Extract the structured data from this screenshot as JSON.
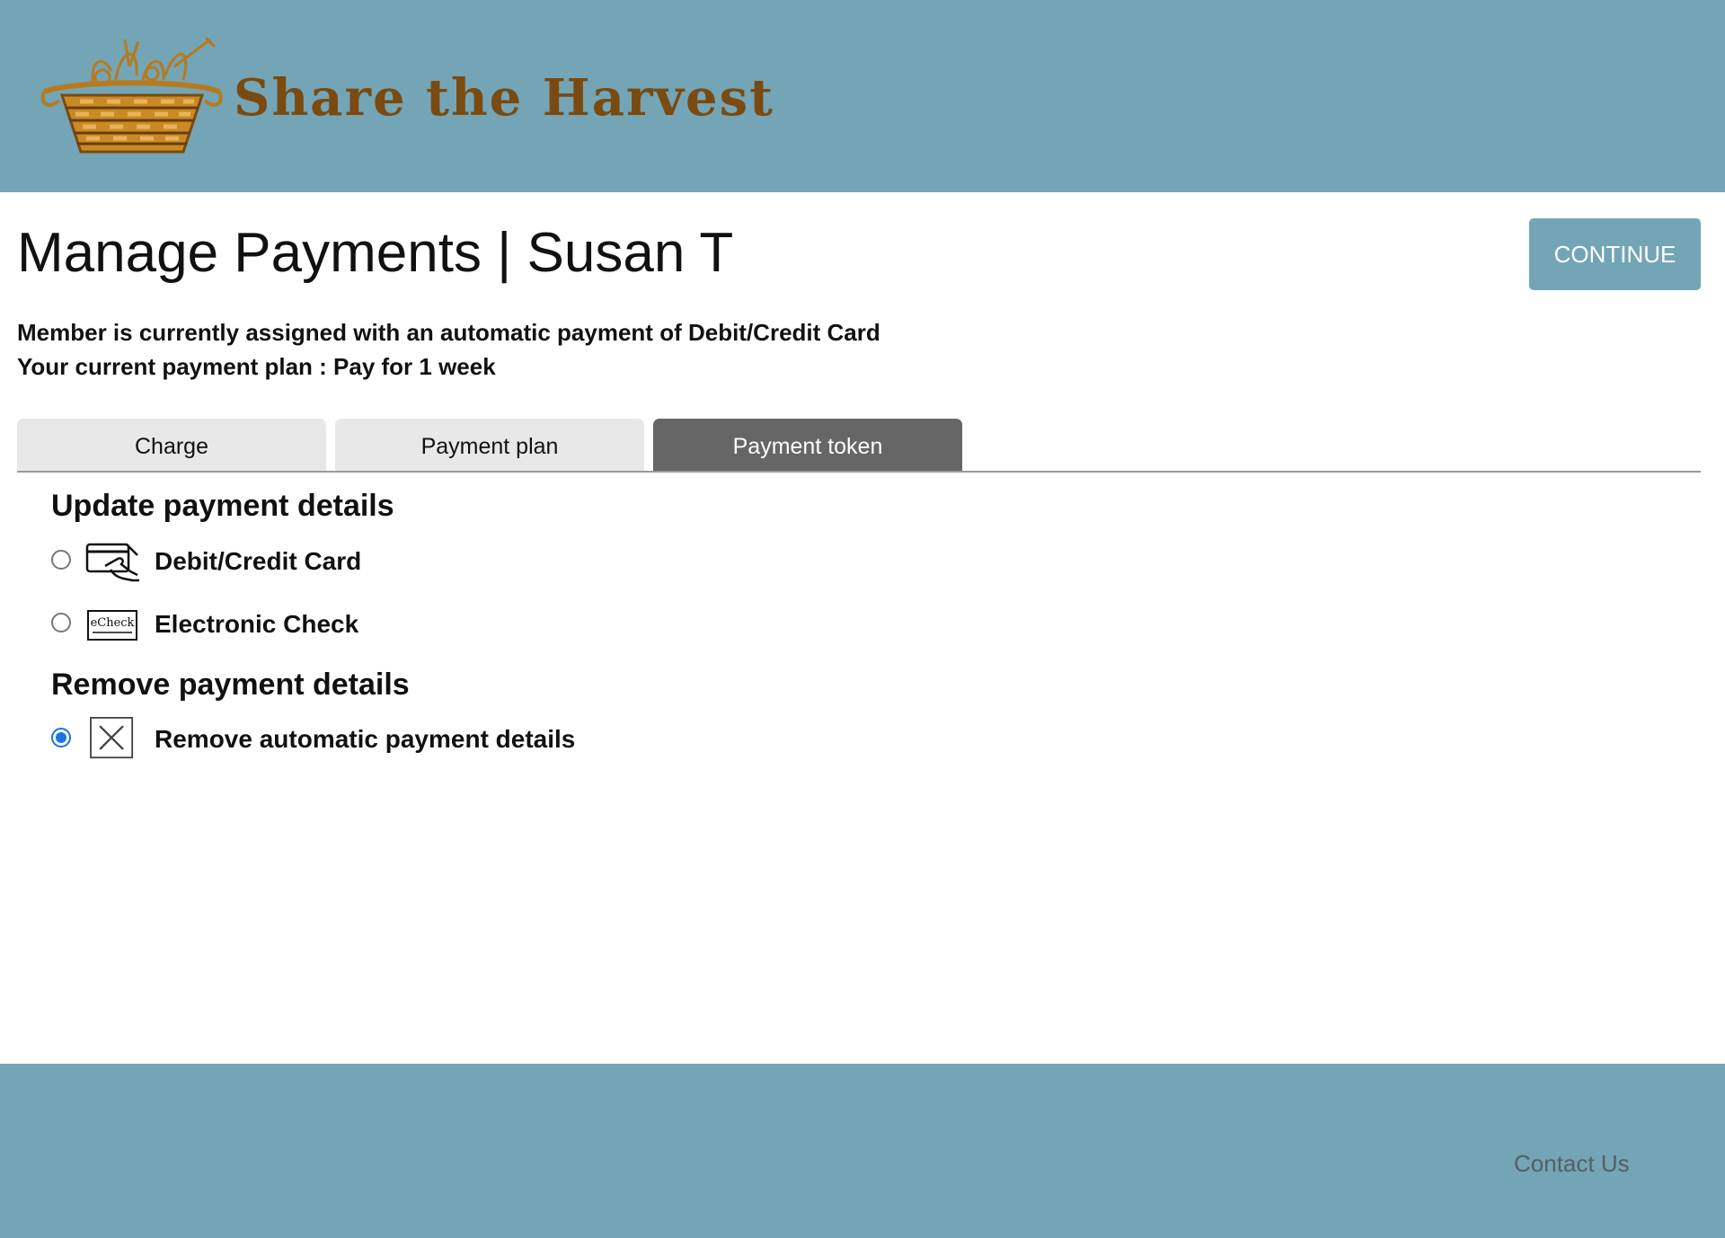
{
  "header": {
    "brand_name": "Share the Harvest",
    "logo_icon": "harvest-basket-logo",
    "background_color": "#73a5b6",
    "brand_color": "#7a4a10"
  },
  "main": {
    "title": "Manage Payments | Susan T",
    "continue_label": "CONTINUE",
    "info_lines": [
      "Member is currently assigned with an automatic payment of Debit/Credit Card",
      "Your current payment plan : Pay for 1 week"
    ],
    "tabs": [
      {
        "label": "Charge",
        "active": false
      },
      {
        "label": "Payment plan",
        "active": false
      },
      {
        "label": "Payment token",
        "active": true
      }
    ],
    "update_section": {
      "heading": "Update payment details",
      "options": [
        {
          "label": "Debit/Credit Card",
          "icon": "credit-card-icon",
          "checked": false
        },
        {
          "label": "Electronic Check",
          "icon": "echeck-icon",
          "icon_text": "eCheck",
          "checked": false
        }
      ]
    },
    "remove_section": {
      "heading": "Remove payment details",
      "options": [
        {
          "label": "Remove automatic payment details",
          "icon": "remove-x-icon",
          "checked": true
        }
      ]
    }
  },
  "footer": {
    "contact_label": "Contact Us"
  },
  "colors": {
    "accent": "#73a5b6",
    "active_tab": "#666666",
    "inactive_tab": "#e8e8e8",
    "radio_checked": "#1a73e8"
  }
}
